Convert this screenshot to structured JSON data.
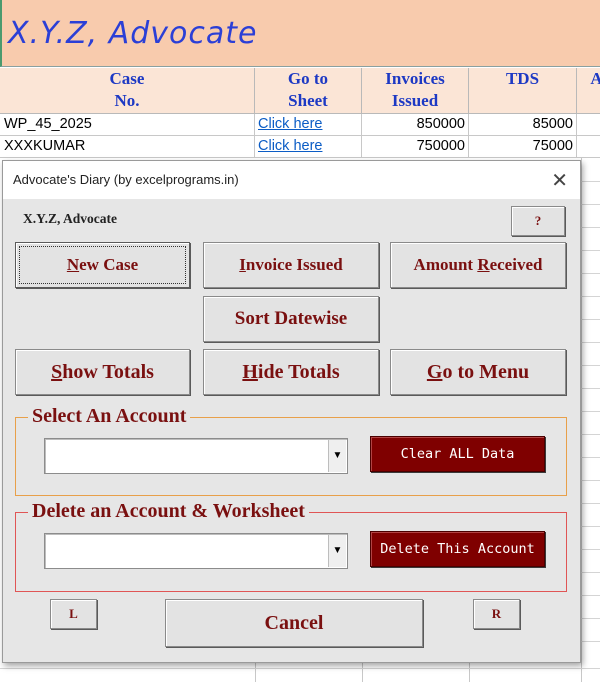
{
  "sheet": {
    "title": "X.Y.Z, Advocate",
    "headers": [
      {
        "line1": "Case",
        "line2": "No."
      },
      {
        "line1": "Go to",
        "line2": "Sheet"
      },
      {
        "line1": "Invoices",
        "line2": "Issued"
      },
      {
        "line1": "TDS",
        "line2": ""
      },
      {
        "line1": "A",
        "line2": ""
      }
    ],
    "rows": [
      {
        "case": "WP_45_2025",
        "link": "Click here",
        "invoice": "850000",
        "tds": "85000"
      },
      {
        "case": "XXXKUMAR",
        "link": "Click here",
        "invoice": "750000",
        "tds": "75000"
      }
    ]
  },
  "dialog": {
    "title": "Advocate's Diary (by excelprograms.in)",
    "close_symbol": "✕",
    "owner_label": "X.Y.Z, Advocate",
    "help_label": "?",
    "buttons": {
      "new_case": {
        "u": "N",
        "rest": "ew Case"
      },
      "invoice_issued": {
        "u": "I",
        "rest": "nvoice Issued"
      },
      "amount_received_pre": "Amount ",
      "amount_received_u": "R",
      "amount_received_post": "eceived",
      "sort_datewise": "Sort Datewise",
      "show_totals": {
        "u": "S",
        "rest": "how Totals"
      },
      "hide_totals": {
        "u": "H",
        "rest": "ide Totals"
      },
      "go_to_menu": {
        "u": "G",
        "rest": "o to Menu"
      }
    },
    "select_account": {
      "legend": "Select An Account",
      "combo_value": "",
      "action_label": "Clear ALL Data"
    },
    "delete_account": {
      "legend": "Delete an Account & Worksheet",
      "combo_value": "",
      "action_label": "Delete This Account"
    },
    "left_label": "L",
    "right_label": "R",
    "cancel_label": "Cancel",
    "dropdown_symbol": "▼"
  },
  "colors": {
    "title_band": "#f8cbad",
    "header_band": "#fbe5d6",
    "header_text": "#1d39c4",
    "dialog_text": "#7a1010",
    "action_button": "#7f0000"
  }
}
